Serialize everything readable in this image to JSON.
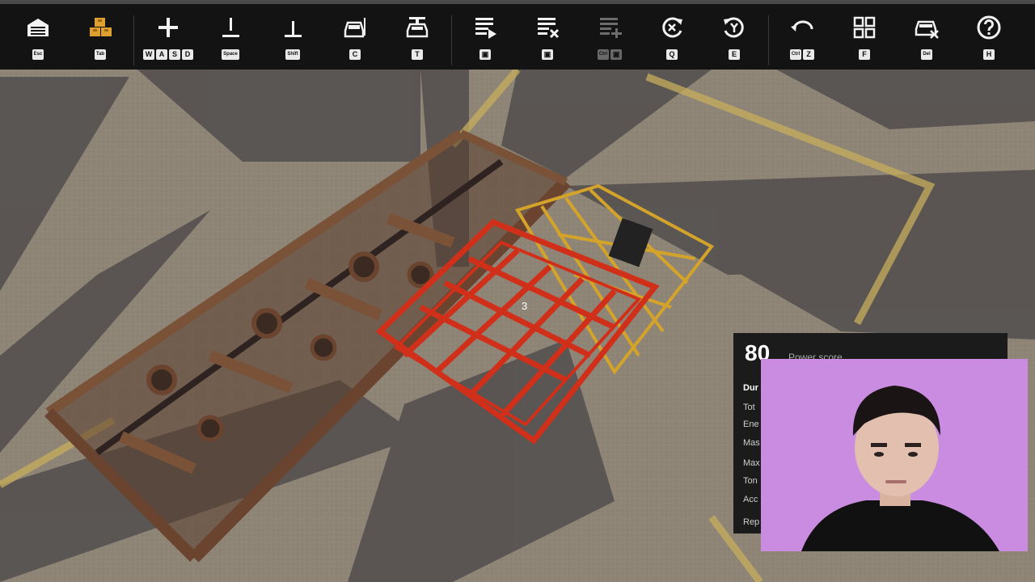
{
  "toolbar": {
    "items": [
      {
        "name": "garage",
        "icon": "garage-icon",
        "keys": [
          "Esc"
        ]
      },
      {
        "name": "parts",
        "icon": "boxes-icon",
        "keys": [
          "Tab"
        ],
        "accent": "#e0a030"
      },
      {
        "name": "move-camera",
        "icon": "move-plus-icon",
        "keys": [
          "W",
          "A",
          "S",
          "D"
        ]
      },
      {
        "name": "camera-up",
        "icon": "camera-up-icon",
        "keys": [
          "Space"
        ]
      },
      {
        "name": "camera-down",
        "icon": "camera-down-icon",
        "keys": [
          "Shift"
        ]
      },
      {
        "name": "vehicle-view",
        "icon": "vehicle-view-icon",
        "keys": [
          "C"
        ]
      },
      {
        "name": "test-drive",
        "icon": "test-drive-icon",
        "keys": [
          "T"
        ]
      },
      {
        "name": "add-part",
        "icon": "list-add-icon",
        "keys": [
          "mouse-left"
        ]
      },
      {
        "name": "remove-part",
        "icon": "list-remove-icon",
        "keys": [
          "mouse-right"
        ]
      },
      {
        "name": "copy-part",
        "icon": "list-copy-icon",
        "keys": [
          "Ctrl",
          "mouse"
        ],
        "disabled": true
      },
      {
        "name": "rotate-q",
        "icon": "rotate-left-icon",
        "keys": [
          "Q"
        ]
      },
      {
        "name": "rotate-e",
        "icon": "rotate-right-icon",
        "keys": [
          "E"
        ]
      },
      {
        "name": "undo",
        "icon": "undo-icon",
        "keys": [
          "Ctrl",
          "Z"
        ]
      },
      {
        "name": "grid",
        "icon": "grid-icon",
        "keys": [
          "F"
        ]
      },
      {
        "name": "delete-vehicle",
        "icon": "vehicle-delete-icon",
        "keys": [
          "Del"
        ]
      },
      {
        "name": "help",
        "icon": "help-icon",
        "keys": [
          "H"
        ]
      }
    ]
  },
  "scene": {
    "part_count_label": "3"
  },
  "score_panel": {
    "value": "80",
    "label": "Power score",
    "rows": [
      "Dur",
      "Tot",
      "Ene",
      "Mas",
      "Max",
      "Ton",
      "Acc",
      "Rep"
    ]
  },
  "colors": {
    "toolbar_bg": "#131313",
    "selected_part": "#d0301a",
    "cage_part": "#d4a32a",
    "frame_part": "#6b4a35",
    "webcam_bg": "#c98ce0"
  }
}
